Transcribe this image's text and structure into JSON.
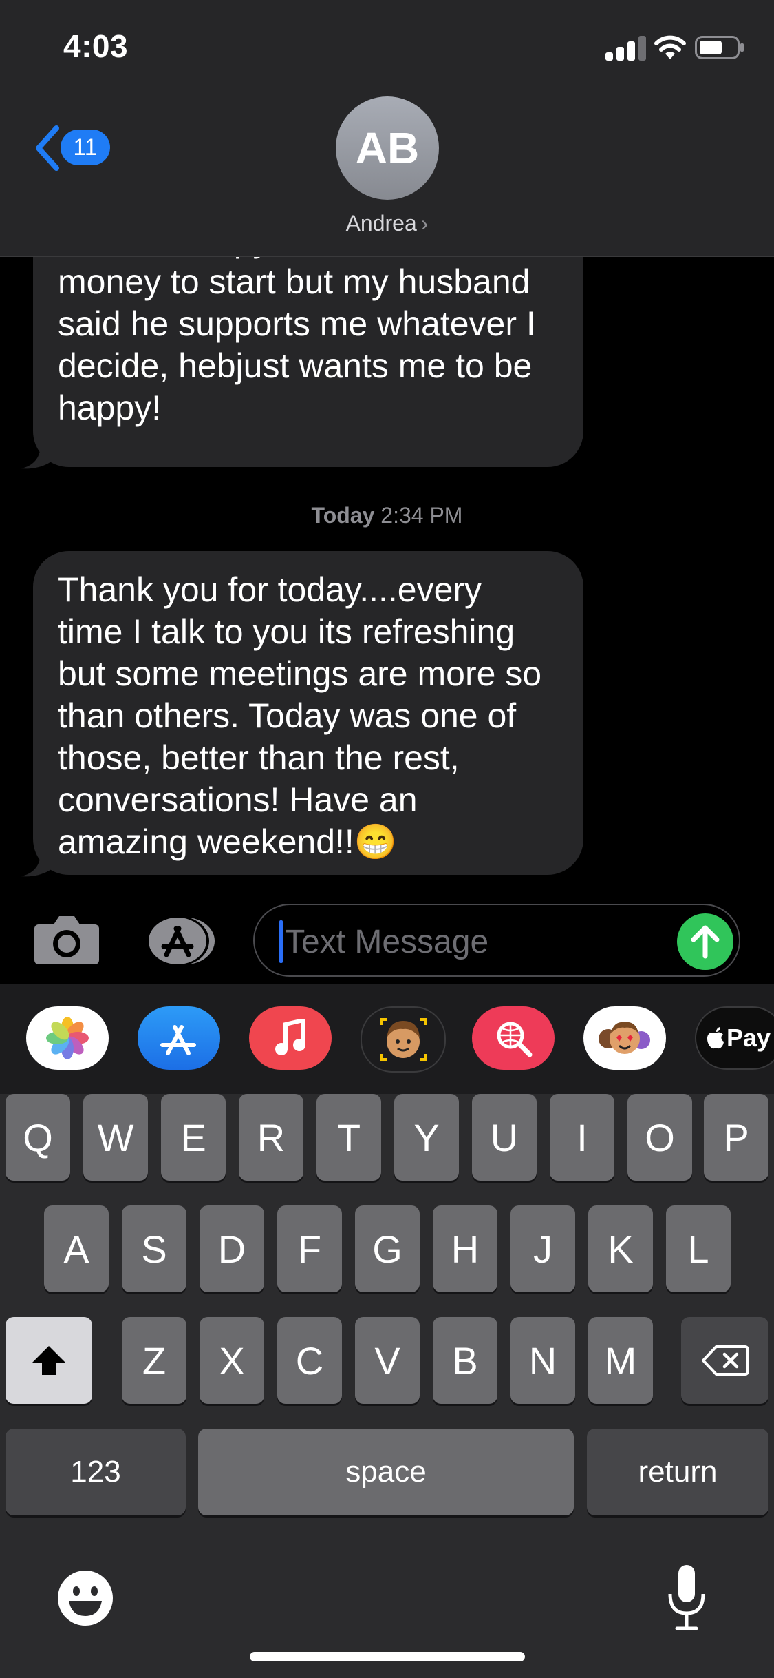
{
  "status_bar": {
    "time": "4:03"
  },
  "header": {
    "back_count": "11",
    "avatar_initials": "AB",
    "contact_name": "Andrea",
    "contact_chevron": "›"
  },
  "conversation": {
    "messages": [
      {
        "sender": "Andrea",
        "text": "vision therapy clinic. A little less money to start but my husband said he supports me whatever I decide, hebjust wants me to be happy!"
      },
      {
        "sender": "Andrea",
        "text": "Thank you for today....every time I talk to you its refreshing but some meetings are more so than others. Today was one of those, better than the rest, conversations! Have an amazing weekend!!😁"
      }
    ],
    "timestamp_day": "Today",
    "timestamp_time": "2:34 PM"
  },
  "input": {
    "placeholder": "Text Message"
  },
  "app_drawer": {
    "apps": [
      {
        "name": "photos-app-icon"
      },
      {
        "name": "app-store-icon"
      },
      {
        "name": "music-app-icon"
      },
      {
        "name": "memoji-icon"
      },
      {
        "name": "images-search-icon"
      },
      {
        "name": "memoji-stickers-icon"
      },
      {
        "name": "apple-pay-icon",
        "label": "Pay"
      }
    ]
  },
  "keyboard": {
    "row1": [
      "Q",
      "W",
      "E",
      "R",
      "T",
      "Y",
      "U",
      "I",
      "O",
      "P"
    ],
    "row2": [
      "A",
      "S",
      "D",
      "F",
      "G",
      "H",
      "J",
      "K",
      "L"
    ],
    "row3": [
      "Z",
      "X",
      "C",
      "V",
      "B",
      "N",
      "M"
    ],
    "numbers_label": "123",
    "space_label": "space",
    "return_label": "return"
  },
  "colors": {
    "accent": "#1f7cf5",
    "send": "#30c55a",
    "bubble": "#262628",
    "keyboard_bg": "#2b2b2d"
  }
}
